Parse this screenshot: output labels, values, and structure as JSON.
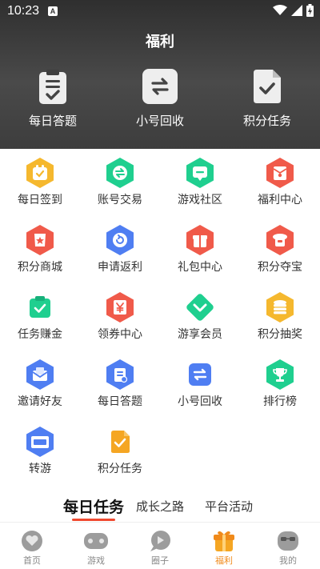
{
  "status": {
    "time": "10:23",
    "notif": "A"
  },
  "header": {
    "title": "福利"
  },
  "quick": [
    {
      "label": "每日答题",
      "icon": "clipboard-check-icon"
    },
    {
      "label": "小号回收",
      "icon": "exchange-arrows-icon"
    },
    {
      "label": "积分任务",
      "icon": "document-check-icon"
    }
  ],
  "grid": [
    {
      "label": "每日签到",
      "icon": "calendar-check-icon",
      "color": "#f5b82e"
    },
    {
      "label": "账号交易",
      "icon": "swap-icon",
      "color": "#1fcf8f"
    },
    {
      "label": "游戏社区",
      "icon": "chat-icon",
      "color": "#1fcf8f"
    },
    {
      "label": "福利中心",
      "icon": "gift-envelope-icon",
      "color": "#f05a4a"
    },
    {
      "label": "积分商城",
      "icon": "shop-bag-icon",
      "color": "#f05a4a"
    },
    {
      "label": "申请返利",
      "icon": "refund-icon",
      "color": "#4f7ef2"
    },
    {
      "label": "礼包中心",
      "icon": "gift-box-icon",
      "color": "#f05a4a"
    },
    {
      "label": "积分夺宝",
      "icon": "treasure-icon",
      "color": "#f05a4a"
    },
    {
      "label": "任务赚金",
      "icon": "task-check-icon",
      "color": "#1fcf8f"
    },
    {
      "label": "领券中心",
      "icon": "coupon-yen-icon",
      "color": "#f05a4a"
    },
    {
      "label": "游享会员",
      "icon": "vip-diamond-icon",
      "color": "#1fcf8f"
    },
    {
      "label": "积分抽奖",
      "icon": "coins-stack-icon",
      "color": "#f5b82e"
    },
    {
      "label": "邀请好友",
      "icon": "invite-mail-icon",
      "color": "#4f7ef2"
    },
    {
      "label": "每日答题",
      "icon": "daily-quiz-icon",
      "color": "#4f7ef2"
    },
    {
      "label": "小号回收",
      "icon": "account-recycle-icon",
      "color": "#4f7ef2"
    },
    {
      "label": "排行榜",
      "icon": "trophy-icon",
      "color": "#1fcf8f"
    },
    {
      "label": "转游",
      "icon": "transfer-game-icon",
      "color": "#4f7ef2"
    },
    {
      "label": "积分任务",
      "icon": "points-task-icon",
      "color": "#f5a623"
    }
  ],
  "tabs": [
    {
      "label": "每日任务"
    },
    {
      "label": "成长之路"
    },
    {
      "label": "平台活动"
    }
  ],
  "nav": [
    {
      "label": "首页",
      "icon": "home-heart-icon"
    },
    {
      "label": "游戏",
      "icon": "gamepad-icon"
    },
    {
      "label": "圈子",
      "icon": "circle-chat-icon"
    },
    {
      "label": "福利",
      "icon": "gift-icon"
    },
    {
      "label": "我的",
      "icon": "profile-face-icon"
    }
  ],
  "colors": {
    "accent": "#f08a1a",
    "tab_underline": "#f0492f"
  }
}
